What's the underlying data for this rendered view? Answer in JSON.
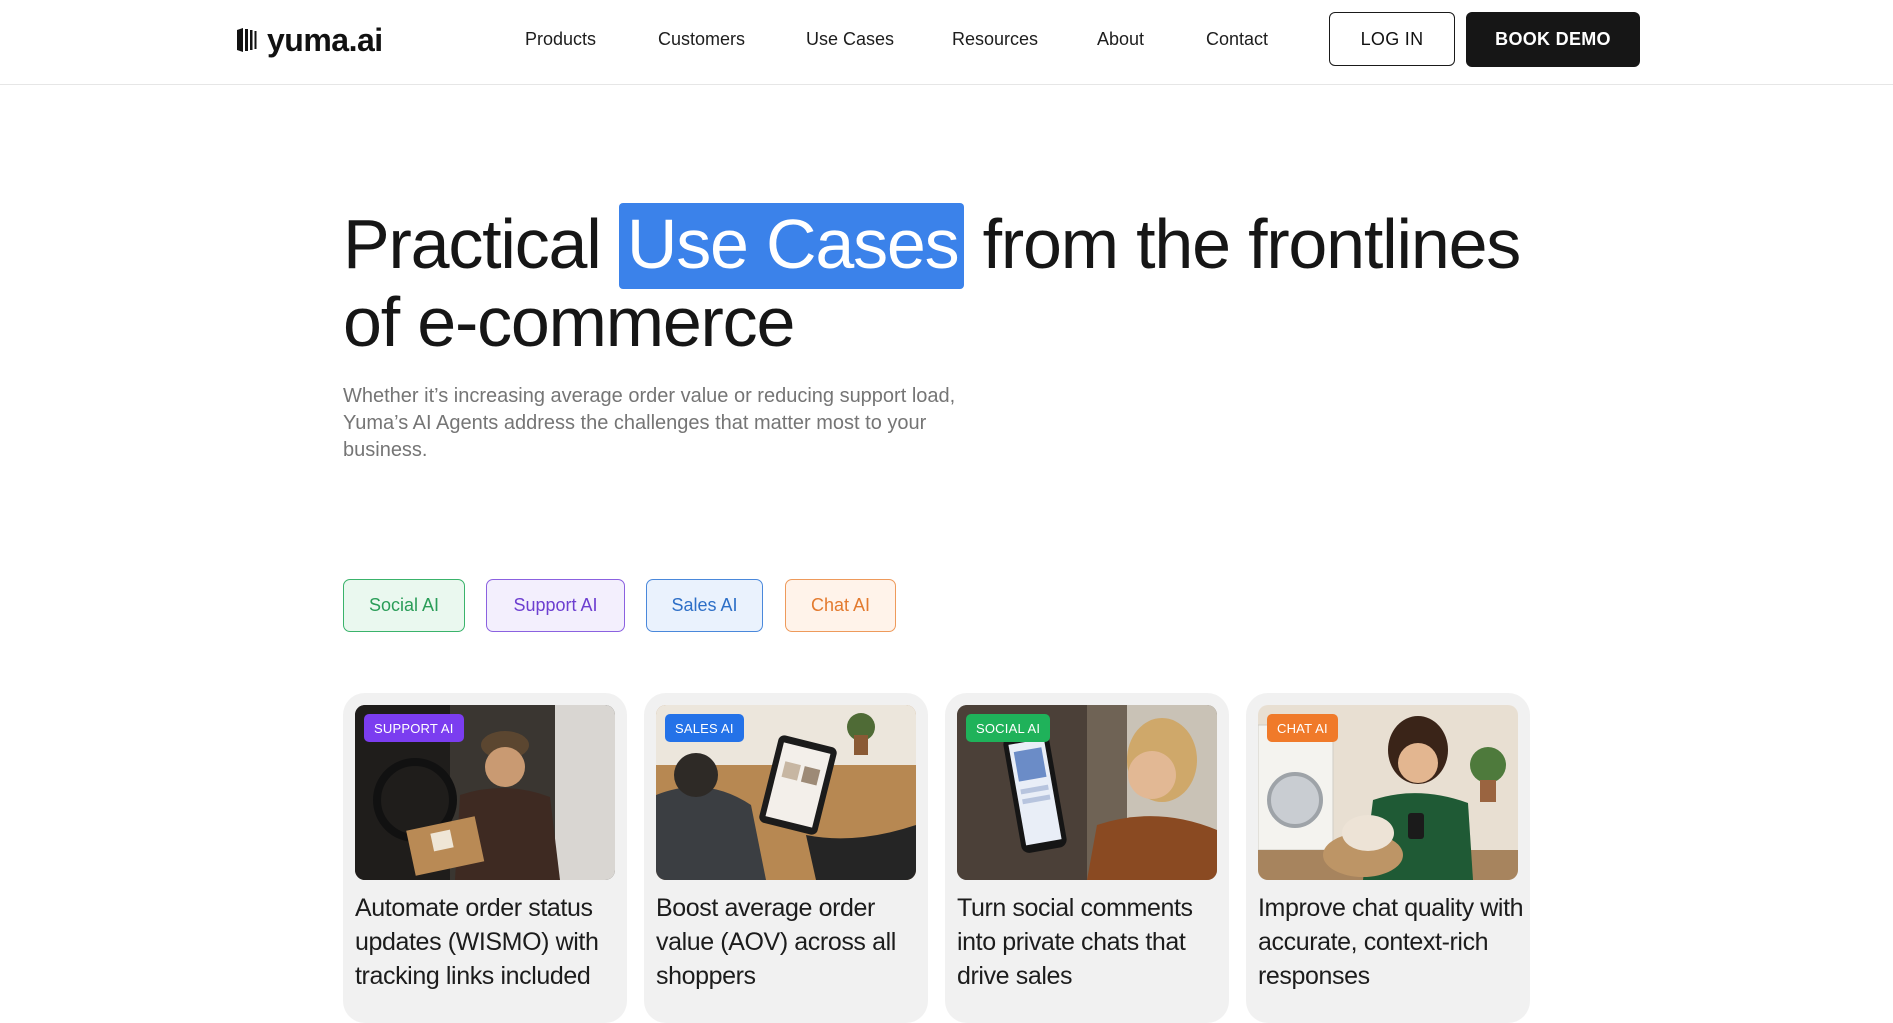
{
  "header": {
    "logo_text": "yuma.ai",
    "nav": [
      "Products",
      "Customers",
      "Use Cases",
      "Resources",
      "About",
      "Contact"
    ],
    "login_label": "LOG IN",
    "demo_label": "BOOK DEMO"
  },
  "hero": {
    "title_before": "Practical ",
    "title_highlight": "Use Cases",
    "title_after": " from the frontlines of e-commerce",
    "subtitle": "Whether it’s increasing average order value or reducing support load, Yuma’s AI Agents address the challenges that matter most to your business."
  },
  "filters": [
    "Social AI",
    "Support AI",
    "Sales AI",
    "Chat AI"
  ],
  "cards": [
    {
      "badge": "SUPPORT AI",
      "title": "Automate order status updates (WISMO) with tracking links included"
    },
    {
      "badge": "SALES AI",
      "title": "Boost average order value (AOV) across all shoppers"
    },
    {
      "badge": "SOCIAL AI",
      "title": "Turn social comments into private chats that drive sales"
    },
    {
      "badge": "CHAT AI",
      "title": "Improve chat quality with accurate, context-rich responses"
    }
  ],
  "colors": {
    "highlight": "#3b82ea",
    "support": "#7b3df0",
    "sales": "#2472e8",
    "social": "#1fb25a",
    "chat": "#f07a2a"
  }
}
